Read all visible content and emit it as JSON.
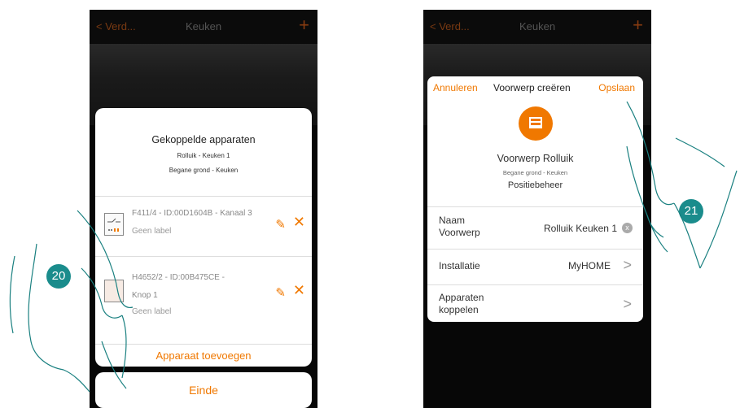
{
  "left": {
    "nav": {
      "back": "< Verd...",
      "title": "Keuken",
      "plus": "+"
    },
    "modal": {
      "title": "Gekoppelde apparaten",
      "sub1": "Rolluik - Keuken 1",
      "sub2": "Begane grond - Keuken",
      "devices": [
        {
          "name_line1": "F411/4 - ID:00D1604B - Kanaal 3",
          "name_line2": "",
          "label": "Geen label"
        },
        {
          "name_line1": "H4652/2 - ID:00B475CE -",
          "name_line2": "Knop 1",
          "label": "Geen label"
        }
      ],
      "add_device": "Apparaat toevoegen"
    },
    "einde": "Einde",
    "step": "20"
  },
  "right": {
    "nav": {
      "back": "< Verd...",
      "title": "Keuken",
      "plus": "+"
    },
    "modal": {
      "cancel": "Annuleren",
      "title": "Voorwerp creëren",
      "save": "Opslaan",
      "object_name": "Voorwerp Rolluik",
      "location": "Begane grond - Keuken",
      "function": "Positiebeheer",
      "rows": [
        {
          "label_line1": "Naam",
          "label_line2": "Voorwerp",
          "value": "Rolluik Keuken 1",
          "action": "x"
        },
        {
          "label_line1": "Installatie",
          "label_line2": "",
          "value": "MyHOME",
          "action": ">"
        },
        {
          "label_line1": "Apparaten",
          "label_line2": "koppelen",
          "value": "",
          "action": ">"
        }
      ]
    },
    "step": "21"
  },
  "colors": {
    "accent": "#f07800",
    "step_badge": "#1a8c8c"
  },
  "icons": {
    "edit": "pencil-icon",
    "remove": "close-icon",
    "chevron": "chevron-right-icon",
    "clear": "clear-icon"
  }
}
